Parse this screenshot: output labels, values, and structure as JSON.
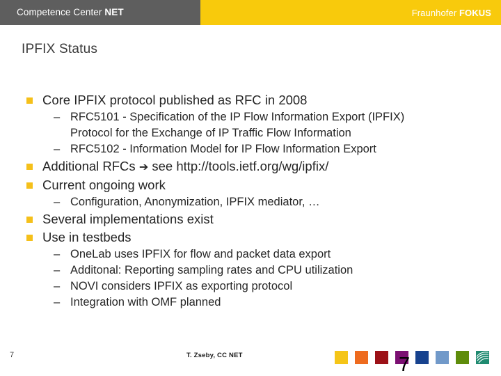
{
  "header": {
    "left_title_plain": "Competence Center ",
    "left_title_strong": "NET",
    "brand_light": "Fraunhofer ",
    "brand_bold": "FOKUS",
    "gray": "#5e5e5e",
    "yellow": "#f8ca0c"
  },
  "title": "IPFIX Status",
  "content": {
    "bullet_marker_color": "#f5c01a",
    "dash": "–",
    "arrow": "➔",
    "items": [
      {
        "level": 1,
        "text": "Core IPFIX protocol published as RFC in 2008"
      },
      {
        "level": 2,
        "line1": "RFC5101 - Specification of the IP Flow Information Export (IPFIX)",
        "line2": "Protocol for the Exchange of IP Traffic Flow Information"
      },
      {
        "level": 2,
        "line1": "RFC5102 - Information Model for IP Flow Information Export"
      },
      {
        "level": 1,
        "text_before_arrow": "Additional RFCs ",
        "text_after_arrow": " see http://tools.ietf.org/wg/ipfix/"
      },
      {
        "level": 1,
        "text": "Current ongoing work"
      },
      {
        "level": 2,
        "line1": "Configuration, Anonymization, IPFIX mediator, …"
      },
      {
        "level": 1,
        "text": "Several implementations exist"
      },
      {
        "level": 1,
        "text": "Use in testbeds"
      },
      {
        "level": 2,
        "line1": "OneLab uses IPFIX for flow and packet data export"
      },
      {
        "level": 2,
        "line1": "Additonal: Reporting sampling rates and CPU utilization"
      },
      {
        "level": 2,
        "line1": "NOVI considers IPFIX as exporting protocol"
      },
      {
        "level": 2,
        "line1": "Integration with OMF planned"
      }
    ]
  },
  "footer": {
    "page_number": "7",
    "author": "T. Zseby, CC NET",
    "large_page_number": "7",
    "swatches": [
      {
        "name": "swatch-yellow",
        "color": "#f5c518"
      },
      {
        "name": "swatch-orange",
        "color": "#ee6b1f"
      },
      {
        "name": "swatch-dark-red",
        "color": "#9c1117"
      },
      {
        "name": "swatch-purple",
        "color": "#7b0f72"
      },
      {
        "name": "swatch-dark-blue",
        "color": "#17428e"
      },
      {
        "name": "swatch-light-blue",
        "color": "#7199c9"
      },
      {
        "name": "swatch-olive-green",
        "color": "#5e8c0b"
      }
    ],
    "logo_color": "#1f8a70",
    "logo_name": "fraunhofer-logo-icon"
  }
}
